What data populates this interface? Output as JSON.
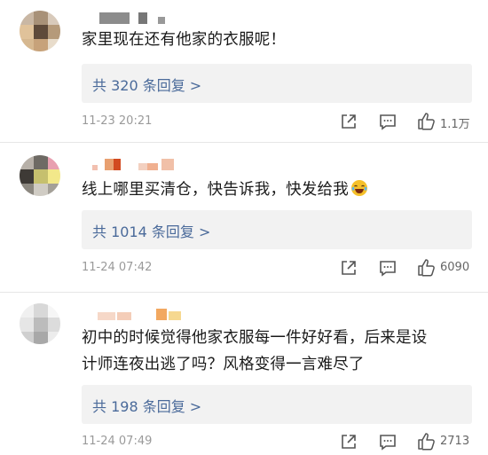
{
  "comments": [
    {
      "text": "家里现在还有他家的衣服呢！",
      "replies_label": "共 320 条回复 >",
      "time": "11-23 20:21",
      "likes": "1.1万"
    },
    {
      "text": "线上哪里买清仓，快告诉我，快发给我",
      "emoji": "laughing-tears-emoji",
      "replies_label": "共 1014 条回复 >",
      "time": "11-24 07:42",
      "likes": "6090"
    },
    {
      "text_line1": "初中的时候觉得他家衣服每一件好好看，后来是设",
      "text_line2": "计师连夜出逃了吗？风格变得一言难尽了",
      "replies_label": "共 198 条回复 >",
      "time": "11-24 07:49",
      "likes": "2713"
    }
  ],
  "icons": {
    "share": "share-icon",
    "comment": "comment-icon",
    "like": "thumbs-up-icon"
  },
  "colors": {
    "reply_link": "#4a6a9a",
    "reply_bg": "#f2f2f2",
    "meta_text": "#9a9a9a"
  }
}
